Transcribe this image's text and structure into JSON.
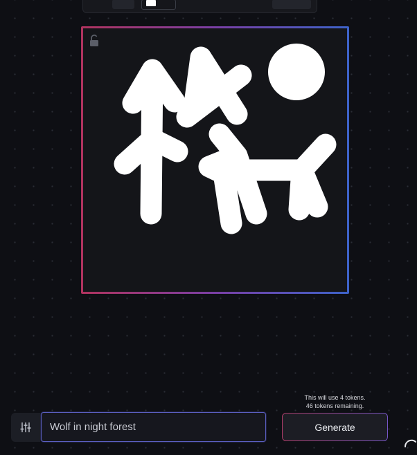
{
  "canvas": {
    "lock_icon": "unlocked-padlock-icon",
    "drawing_description_icon": "freehand-sketch"
  },
  "prompt": {
    "value": "Wolf in night forest",
    "settings_icon": "sliders-icon"
  },
  "generate": {
    "label": "Generate",
    "cost_note": "This will use 4 tokens.",
    "remaining_note": "46 tokens remaining."
  },
  "colors": {
    "background": "#0e0f14",
    "canvas": "#141519",
    "frame_start": "#b0335e",
    "frame_end": "#3d63c9",
    "input_border": "#5b5fc2",
    "stroke": "#ffffff"
  }
}
